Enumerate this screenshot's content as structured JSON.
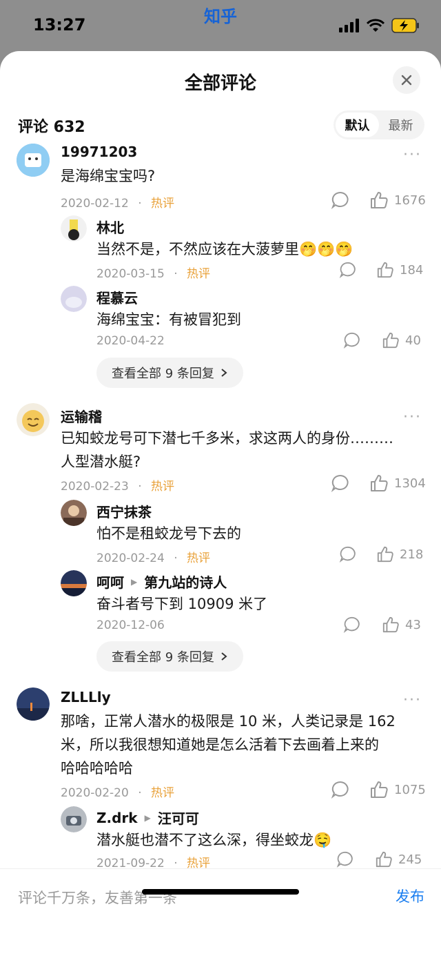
{
  "status": {
    "time": "13:27",
    "app": "知乎"
  },
  "sheet": {
    "title": "全部评论"
  },
  "count_label": "评论 632",
  "sort": {
    "default": "默认",
    "latest": "最新"
  },
  "hot_label": "热评",
  "dot": "·",
  "comments": [
    {
      "user": "19971203",
      "lines": [
        "是海绵宝宝吗?"
      ],
      "date": "2020-02-12",
      "hot": true,
      "likes": "1676",
      "replies": [
        {
          "user": "林北",
          "text": "当然不是，不然应该在大菠萝里🤭🤭🤭",
          "date": "2020-03-15",
          "hot": true,
          "likes": "184"
        },
        {
          "user": "程慕云",
          "text": "海绵宝宝：有被冒犯到",
          "date": "2020-04-22",
          "hot": false,
          "likes": "40"
        }
      ],
      "view_all": "查看全部 9 条回复"
    },
    {
      "user": "运输稽",
      "lines": [
        "已知蛟龙号可下潜七千多米，求这两人的身份………",
        "人型潜水艇?"
      ],
      "date": "2020-02-23",
      "hot": true,
      "likes": "1304",
      "replies": [
        {
          "user": "西宁抹茶",
          "text": "怕不是租蛟龙号下去的",
          "date": "2020-02-24",
          "hot": true,
          "likes": "218"
        },
        {
          "user": "呵呵",
          "reply_to": "第九站的诗人",
          "text": "奋斗者号下到 10909 米了",
          "date": "2020-12-06",
          "hot": false,
          "likes": "43"
        }
      ],
      "view_all": "查看全部 9 条回复"
    },
    {
      "user": "ZLLLly",
      "lines": [
        "那啥，正常人潜水的极限是 10 米，人类记录是 162",
        "米，所以我很想知道她是怎么活着下去画着上来的",
        "哈哈哈哈哈"
      ],
      "date": "2020-02-20",
      "hot": true,
      "likes": "1075",
      "replies": [
        {
          "user": "Z.drk",
          "reply_to": "汪可可",
          "text": "潜水艇也潜不了这么深，得坐蛟龙🤤",
          "date": "2021-09-22",
          "hot": true,
          "likes": "245"
        }
      ]
    }
  ],
  "input": {
    "placeholder": "评论千万条，友善第一条",
    "publish": "发布"
  },
  "colors": {
    "accent_blue": "#1a7ef0",
    "hot_orange": "#e9a23b",
    "app_blue": "#1663d6"
  }
}
